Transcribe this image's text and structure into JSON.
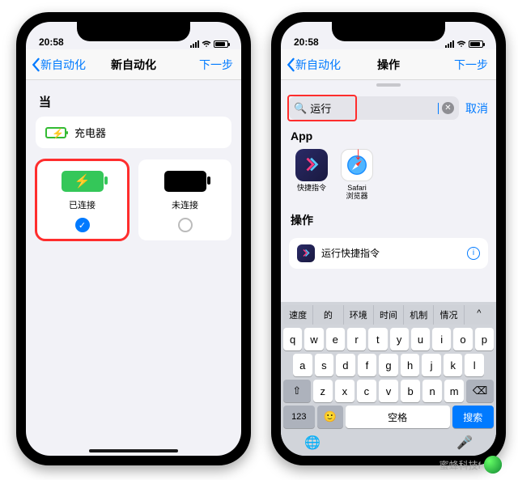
{
  "status": {
    "time": "20:58"
  },
  "phone1": {
    "nav": {
      "back": "新自动化",
      "title": "新自动化",
      "next": "下一步"
    },
    "whenLabel": "当",
    "triggerRow": {
      "label": "充电器"
    },
    "options": {
      "connected": {
        "label": "已连接"
      },
      "disconnected": {
        "label": "未连接"
      }
    }
  },
  "phone2": {
    "nav": {
      "back": "新自动化",
      "title": "操作",
      "next": "下一步"
    },
    "search": {
      "value": "运行",
      "cancel": "取消"
    },
    "appHeader": "App",
    "apps": {
      "shortcuts": "快捷指令",
      "safari": "Safari\n浏览器"
    },
    "actionsHeader": "操作",
    "actionRow": "运行快捷指令",
    "predictions": [
      "速度",
      "的",
      "环境",
      "时间",
      "机制",
      "情况",
      "^"
    ],
    "keys": {
      "row1": [
        "q",
        "w",
        "e",
        "r",
        "t",
        "y",
        "u",
        "i",
        "o",
        "p"
      ],
      "row2": [
        "a",
        "s",
        "d",
        "f",
        "g",
        "h",
        "j",
        "k",
        "l"
      ],
      "row3": [
        "z",
        "x",
        "c",
        "v",
        "b",
        "n",
        "m"
      ],
      "shift": "⇧",
      "del": "⌫",
      "numbers": "123",
      "emoji": "🙂",
      "space": "空格",
      "search": "搜索",
      "globe": "🌐",
      "mic": "🎤"
    }
  },
  "watermark": "蜜蜂科技f"
}
